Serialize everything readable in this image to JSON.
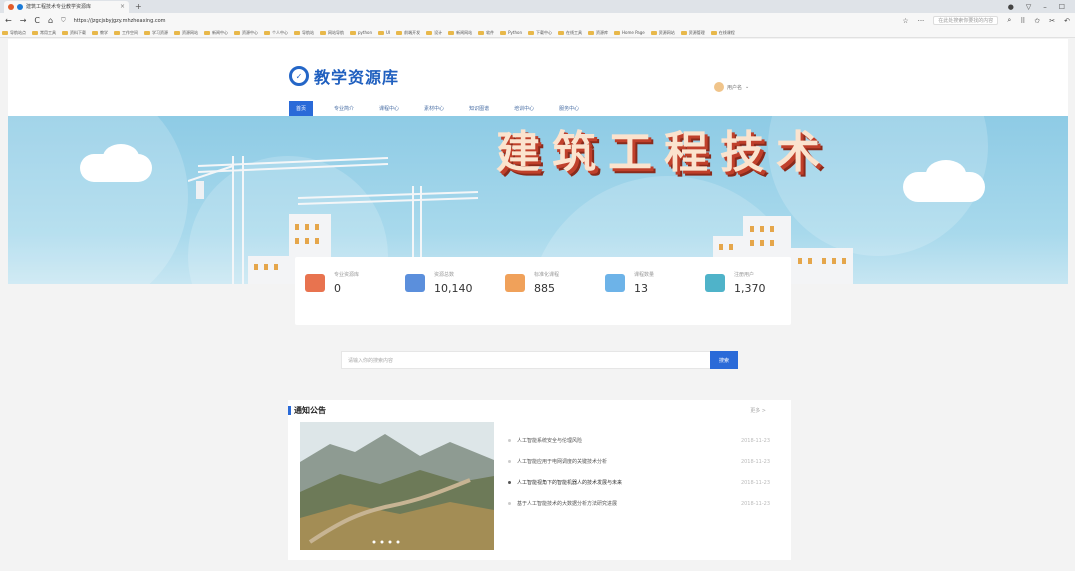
{
  "browser": {
    "tab_title": "建筑工程技术专业教学资源库",
    "url": "https://jzgcjsbyjgzy.mhzheaxing.com",
    "search_placeholder": "在此处搜索你要找的内容",
    "bookmarks": [
      "导航站点",
      "常用工具",
      "资料下载",
      "教学",
      "工作空间",
      "学习资源",
      "资源网站",
      "新闻中心",
      "资源中心",
      "个人中心",
      "导航站",
      "网站导航",
      "python",
      "UI",
      "前端开发",
      "设计",
      "新闻网站",
      "软件",
      "Python",
      "下载中心",
      "在线工具",
      "资源库",
      "Home Page",
      "资源网站",
      "资源管理",
      "在线课程"
    ]
  },
  "header": {
    "logo_text": "教学资源库",
    "user_name": "用户名",
    "nav": [
      "首页",
      "专业简介",
      "课程中心",
      "素材中心",
      "知识图谱",
      "培训中心",
      "服务中心"
    ]
  },
  "banner": {
    "title": "建筑工程技术"
  },
  "stats": [
    {
      "label": "专业资源库",
      "value": "0",
      "icon": "users-icon",
      "color": "#e8734f"
    },
    {
      "label": "资源总数",
      "value": "10,140",
      "icon": "chart-icon",
      "color": "#5b8fdc"
    },
    {
      "label": "标准化课程",
      "value": "885",
      "icon": "book-icon",
      "color": "#f0a15a"
    },
    {
      "label": "课程数量",
      "value": "13",
      "icon": "video-icon",
      "color": "#6db3e8"
    },
    {
      "label": "注册用户",
      "value": "1,370",
      "icon": "people-icon",
      "color": "#4fb3c9"
    }
  ],
  "search": {
    "placeholder": "请输入你的搜索内容",
    "button": "搜索"
  },
  "notice": {
    "title": "通知公告",
    "more": "更多 >",
    "items": [
      {
        "text": "人工智能系统安全与伦理风险",
        "date": "2018-11-23"
      },
      {
        "text": "人工智能应用于电网调度的关键技术分析",
        "date": "2018-11-23"
      },
      {
        "text": "人工智能视角下的智能机器人的技术发展与未来",
        "date": "2018-11-23"
      },
      {
        "text": "基于人工智能技术的大数据分析方法研究进展",
        "date": "2018-11-23"
      }
    ]
  }
}
